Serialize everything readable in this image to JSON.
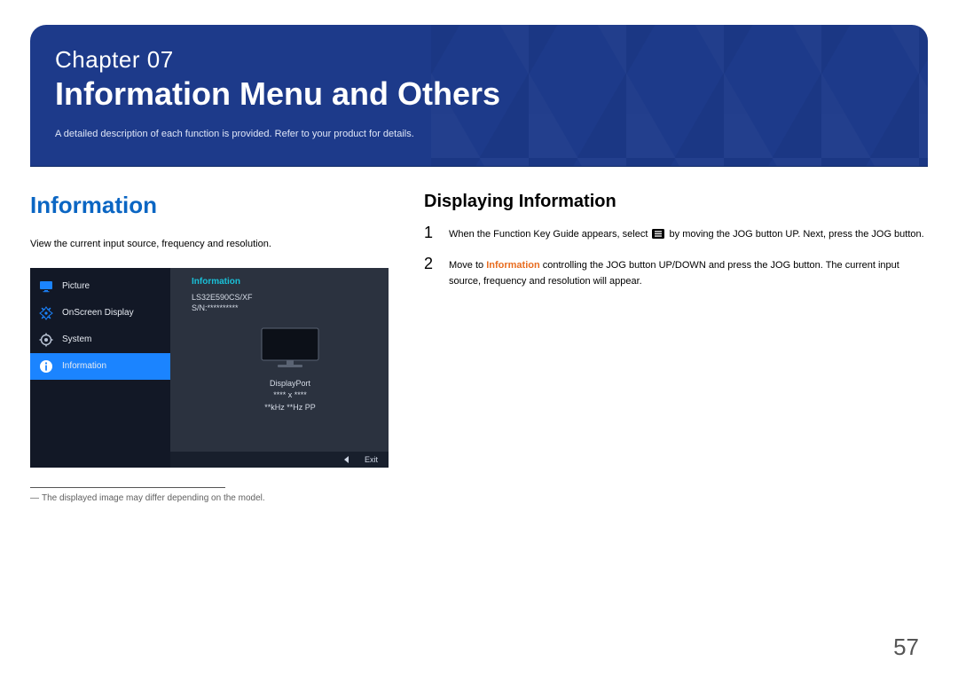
{
  "banner": {
    "chapter_prefix": "Chapter ",
    "chapter_number": "07",
    "chapter_title": "Information Menu and Others",
    "subtitle": "A detailed description of each function is provided. Refer to your product for details."
  },
  "left": {
    "heading": "Information",
    "paragraph": "View the current input source, frequency and resolution.",
    "footnote": "The displayed image may differ depending on the model."
  },
  "osd": {
    "sidebar": [
      {
        "icon": "monitor",
        "label": "Picture"
      },
      {
        "icon": "target",
        "label": "OnScreen Display"
      },
      {
        "icon": "gear",
        "label": "System"
      },
      {
        "icon": "info",
        "label": "Information",
        "selected": true
      }
    ],
    "panel": {
      "title": "Information",
      "model": "LS32E590CS/XF",
      "serial": "S/N:**********",
      "port": "DisplayPort",
      "resolution": "**** x ****",
      "freq": "**kHz **Hz PP"
    },
    "footer": {
      "exit": "Exit"
    }
  },
  "right": {
    "heading": "Displaying Information",
    "step1_a": "When the Function Key Guide appears, select ",
    "step1_b": " by moving the JOG button UP. Next, press the JOG button.",
    "step2_a": "Move to ",
    "step2_kw": "Information",
    "step2_b": " controlling the JOG button UP/DOWN and press the JOG button. The current input source, frequency and resolution will appear."
  },
  "page_number": "57"
}
